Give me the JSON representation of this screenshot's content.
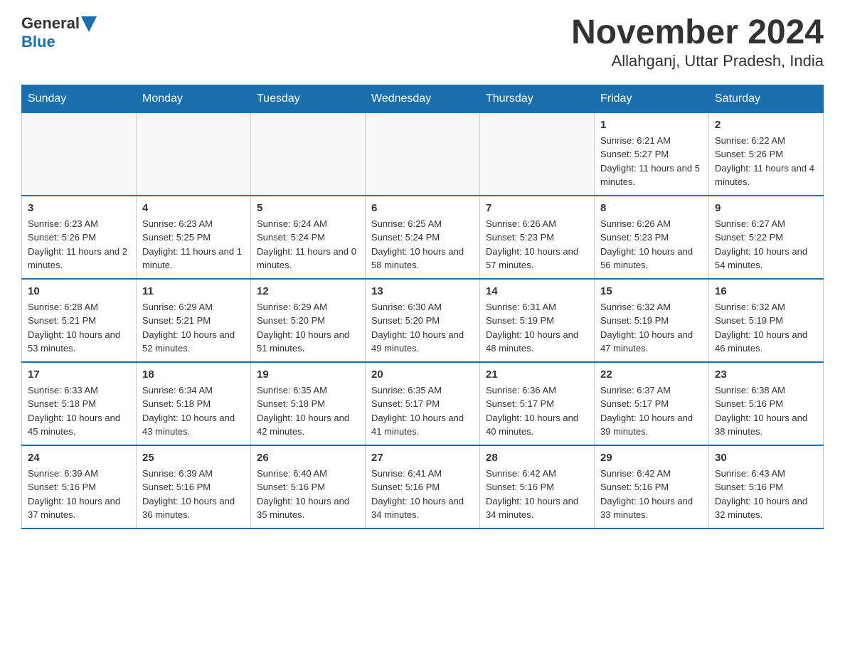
{
  "header": {
    "logo_general": "General",
    "logo_blue": "Blue",
    "title": "November 2024",
    "subtitle": "Allahganj, Uttar Pradesh, India"
  },
  "days_of_week": [
    "Sunday",
    "Monday",
    "Tuesday",
    "Wednesday",
    "Thursday",
    "Friday",
    "Saturday"
  ],
  "weeks": [
    [
      {
        "day": "",
        "info": ""
      },
      {
        "day": "",
        "info": ""
      },
      {
        "day": "",
        "info": ""
      },
      {
        "day": "",
        "info": ""
      },
      {
        "day": "",
        "info": ""
      },
      {
        "day": "1",
        "info": "Sunrise: 6:21 AM\nSunset: 5:27 PM\nDaylight: 11 hours and 5 minutes."
      },
      {
        "day": "2",
        "info": "Sunrise: 6:22 AM\nSunset: 5:26 PM\nDaylight: 11 hours and 4 minutes."
      }
    ],
    [
      {
        "day": "3",
        "info": "Sunrise: 6:23 AM\nSunset: 5:26 PM\nDaylight: 11 hours and 2 minutes."
      },
      {
        "day": "4",
        "info": "Sunrise: 6:23 AM\nSunset: 5:25 PM\nDaylight: 11 hours and 1 minute."
      },
      {
        "day": "5",
        "info": "Sunrise: 6:24 AM\nSunset: 5:24 PM\nDaylight: 11 hours and 0 minutes."
      },
      {
        "day": "6",
        "info": "Sunrise: 6:25 AM\nSunset: 5:24 PM\nDaylight: 10 hours and 58 minutes."
      },
      {
        "day": "7",
        "info": "Sunrise: 6:26 AM\nSunset: 5:23 PM\nDaylight: 10 hours and 57 minutes."
      },
      {
        "day": "8",
        "info": "Sunrise: 6:26 AM\nSunset: 5:23 PM\nDaylight: 10 hours and 56 minutes."
      },
      {
        "day": "9",
        "info": "Sunrise: 6:27 AM\nSunset: 5:22 PM\nDaylight: 10 hours and 54 minutes."
      }
    ],
    [
      {
        "day": "10",
        "info": "Sunrise: 6:28 AM\nSunset: 5:21 PM\nDaylight: 10 hours and 53 minutes."
      },
      {
        "day": "11",
        "info": "Sunrise: 6:29 AM\nSunset: 5:21 PM\nDaylight: 10 hours and 52 minutes."
      },
      {
        "day": "12",
        "info": "Sunrise: 6:29 AM\nSunset: 5:20 PM\nDaylight: 10 hours and 51 minutes."
      },
      {
        "day": "13",
        "info": "Sunrise: 6:30 AM\nSunset: 5:20 PM\nDaylight: 10 hours and 49 minutes."
      },
      {
        "day": "14",
        "info": "Sunrise: 6:31 AM\nSunset: 5:19 PM\nDaylight: 10 hours and 48 minutes."
      },
      {
        "day": "15",
        "info": "Sunrise: 6:32 AM\nSunset: 5:19 PM\nDaylight: 10 hours and 47 minutes."
      },
      {
        "day": "16",
        "info": "Sunrise: 6:32 AM\nSunset: 5:19 PM\nDaylight: 10 hours and 46 minutes."
      }
    ],
    [
      {
        "day": "17",
        "info": "Sunrise: 6:33 AM\nSunset: 5:18 PM\nDaylight: 10 hours and 45 minutes."
      },
      {
        "day": "18",
        "info": "Sunrise: 6:34 AM\nSunset: 5:18 PM\nDaylight: 10 hours and 43 minutes."
      },
      {
        "day": "19",
        "info": "Sunrise: 6:35 AM\nSunset: 5:18 PM\nDaylight: 10 hours and 42 minutes."
      },
      {
        "day": "20",
        "info": "Sunrise: 6:35 AM\nSunset: 5:17 PM\nDaylight: 10 hours and 41 minutes."
      },
      {
        "day": "21",
        "info": "Sunrise: 6:36 AM\nSunset: 5:17 PM\nDaylight: 10 hours and 40 minutes."
      },
      {
        "day": "22",
        "info": "Sunrise: 6:37 AM\nSunset: 5:17 PM\nDaylight: 10 hours and 39 minutes."
      },
      {
        "day": "23",
        "info": "Sunrise: 6:38 AM\nSunset: 5:16 PM\nDaylight: 10 hours and 38 minutes."
      }
    ],
    [
      {
        "day": "24",
        "info": "Sunrise: 6:39 AM\nSunset: 5:16 PM\nDaylight: 10 hours and 37 minutes."
      },
      {
        "day": "25",
        "info": "Sunrise: 6:39 AM\nSunset: 5:16 PM\nDaylight: 10 hours and 36 minutes."
      },
      {
        "day": "26",
        "info": "Sunrise: 6:40 AM\nSunset: 5:16 PM\nDaylight: 10 hours and 35 minutes."
      },
      {
        "day": "27",
        "info": "Sunrise: 6:41 AM\nSunset: 5:16 PM\nDaylight: 10 hours and 34 minutes."
      },
      {
        "day": "28",
        "info": "Sunrise: 6:42 AM\nSunset: 5:16 PM\nDaylight: 10 hours and 34 minutes."
      },
      {
        "day": "29",
        "info": "Sunrise: 6:42 AM\nSunset: 5:16 PM\nDaylight: 10 hours and 33 minutes."
      },
      {
        "day": "30",
        "info": "Sunrise: 6:43 AM\nSunset: 5:16 PM\nDaylight: 10 hours and 32 minutes."
      }
    ]
  ]
}
